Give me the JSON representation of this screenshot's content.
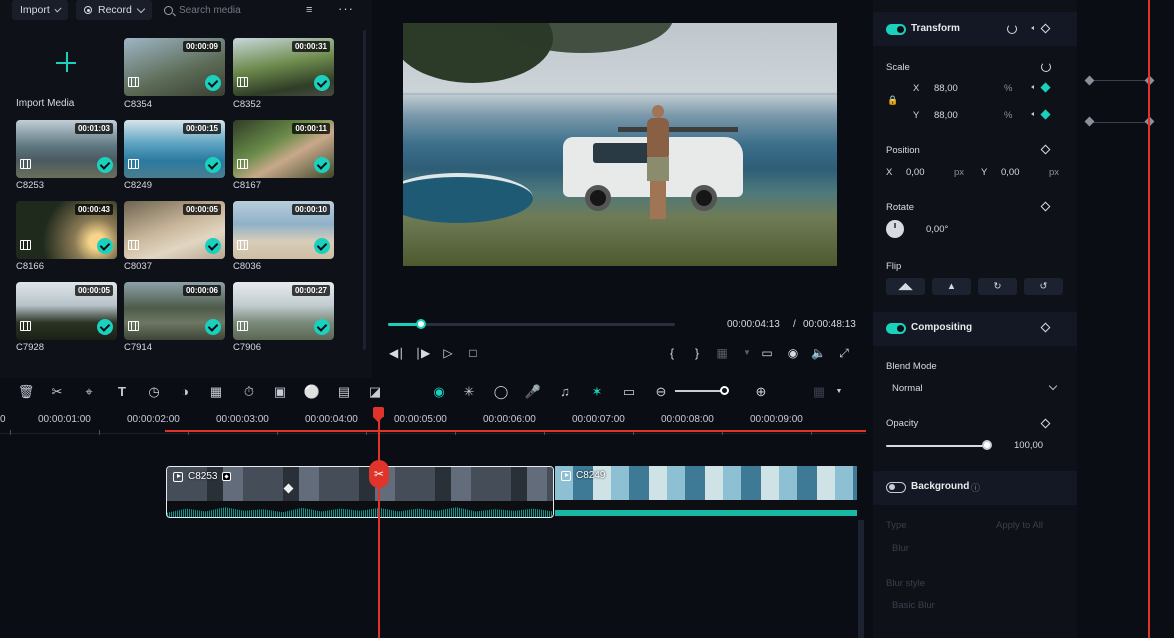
{
  "media_toolbar": {
    "import_label": "Import",
    "record_label": "Record",
    "search_placeholder": "Search media"
  },
  "media": {
    "import_media_label": "Import Media",
    "clips": [
      {
        "name": "C8354",
        "duration": "00:00:09"
      },
      {
        "name": "C8352",
        "duration": "00:00:31"
      },
      {
        "name": "C8253",
        "duration": "00:01:03"
      },
      {
        "name": "C8249",
        "duration": "00:00:15"
      },
      {
        "name": "C8167",
        "duration": "00:00:11"
      },
      {
        "name": "C8166",
        "duration": "00:00:43"
      },
      {
        "name": "C8037",
        "duration": "00:00:05"
      },
      {
        "name": "C8036",
        "duration": "00:00:10"
      },
      {
        "name": "C7928",
        "duration": "00:00:05"
      },
      {
        "name": "C7914",
        "duration": "00:00:06"
      },
      {
        "name": "C7906",
        "duration": "00:00:27"
      }
    ]
  },
  "player": {
    "current_time": "00:00:04:13",
    "separator": "/",
    "total_time": "00:00:48:13",
    "progress": 0.115
  },
  "timeline": {
    "ruler_labels": [
      "0",
      "00:00:01:00",
      "00:00:02:00",
      "00:00:03:00",
      "00:00:04:00",
      "00:00:05:00",
      "00:00:06:00",
      "00:00:07:00",
      "00:00:08:00",
      "00:00:09:00"
    ],
    "clips": [
      {
        "name": "C8253"
      },
      {
        "name": "C8249"
      }
    ]
  },
  "properties": {
    "transform": {
      "title": "Transform",
      "scale_label": "Scale",
      "scale_x_label": "X",
      "scale_x": "88,00",
      "scale_y_label": "Y",
      "scale_y": "88,00",
      "percent_unit": "%",
      "position_label": "Position",
      "pos_x_label": "X",
      "pos_x": "0,00",
      "pos_y_label": "Y",
      "pos_y": "0,00",
      "px_unit": "px",
      "rotate_label": "Rotate",
      "rotate_value": "0,00°",
      "flip_label": "Flip"
    },
    "compositing": {
      "title": "Compositing",
      "blend_mode_label": "Blend Mode",
      "blend_mode_value": "Normal",
      "opacity_label": "Opacity",
      "opacity_value": "100,00",
      "opacity_fraction": 1.0
    },
    "background": {
      "title": "Background",
      "type_label": "Type",
      "apply_all_label": "Apply to All",
      "type_value": "Blur",
      "blur_style_label": "Blur style",
      "blur_style_value": "Basic Blur"
    }
  },
  "colors": {
    "accent": "#19d1bd",
    "playhead": "#e0342b",
    "background": "#0b0d14"
  }
}
